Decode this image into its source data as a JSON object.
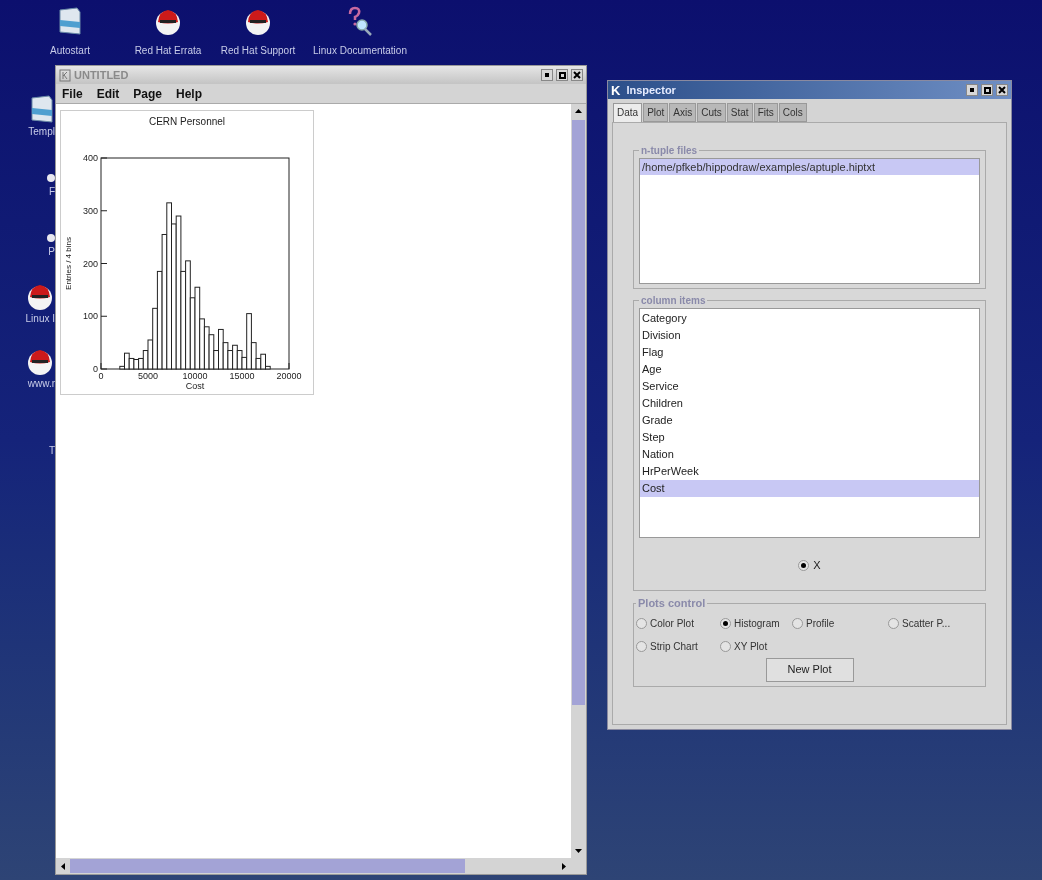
{
  "desktop": {
    "top_icons": [
      {
        "kind": "folder",
        "label": "Autostart"
      },
      {
        "kind": "redhat",
        "label": "Red Hat Errata"
      },
      {
        "kind": "redhat",
        "label": "Red Hat Support"
      },
      {
        "kind": "help",
        "label": "Linux Documentation"
      }
    ],
    "side_icons": [
      {
        "kind": "folder",
        "label": "Templ"
      },
      {
        "kind": "dot",
        "label": "F"
      },
      {
        "kind": "dot",
        "label": "P"
      },
      {
        "kind": "redhat",
        "label": "Linux I"
      },
      {
        "kind": "redhat",
        "label": "www.r"
      },
      {
        "kind": "none",
        "label": "T"
      }
    ]
  },
  "main_window": {
    "title": "UNTITLED",
    "menu": [
      "File",
      "Edit",
      "Page",
      "Help"
    ],
    "plot": {
      "chart_data": {
        "type": "bar",
        "title": "CERN Personnel",
        "xlabel": "Cost",
        "ylabel": "Entries / 4 bins",
        "xlim": [
          0,
          20000
        ],
        "ylim": [
          0,
          400
        ],
        "xticks": [
          0,
          5000,
          10000,
          15000,
          20000
        ],
        "yticks": [
          0,
          100,
          200,
          300,
          400
        ],
        "x": [
          0,
          500,
          1000,
          1500,
          2000,
          2500,
          3000,
          3500,
          4000,
          4500,
          5000,
          5500,
          6000,
          6500,
          7000,
          7500,
          8000,
          8500,
          9000,
          9500,
          10000,
          10500,
          11000,
          11500,
          12000,
          12500,
          13000,
          13500,
          14000,
          14500,
          15000,
          15500,
          16000,
          16500,
          17000,
          17500,
          18000,
          18500,
          19000,
          19500
        ],
        "values": [
          0,
          0,
          0,
          0,
          5,
          30,
          20,
          18,
          20,
          35,
          55,
          115,
          185,
          255,
          315,
          275,
          290,
          185,
          205,
          135,
          155,
          95,
          80,
          65,
          35,
          75,
          50,
          35,
          45,
          35,
          22,
          105,
          50,
          20,
          28,
          5,
          0,
          0,
          0,
          0
        ]
      }
    }
  },
  "inspector": {
    "logo": "K",
    "title": "Inspector",
    "tabs": [
      {
        "label": "Data",
        "selected": true
      },
      {
        "label": "Plot",
        "selected": false
      },
      {
        "label": "Axis",
        "selected": false
      },
      {
        "label": "Cuts",
        "selected": false
      },
      {
        "label": "Stat",
        "selected": false
      },
      {
        "label": "Fits",
        "selected": false
      },
      {
        "label": "Cols",
        "selected": false
      }
    ],
    "ntuple_files": {
      "legend": "n-tuple files",
      "items": [
        {
          "label": "/home/pfkeb/hippodraw/examples/aptuple.hiptxt",
          "selected": true
        }
      ]
    },
    "column_items": {
      "legend": "column items",
      "items": [
        {
          "label": "Category",
          "selected": false
        },
        {
          "label": "Division",
          "selected": false
        },
        {
          "label": "Flag",
          "selected": false
        },
        {
          "label": "Age",
          "selected": false
        },
        {
          "label": "Service",
          "selected": false
        },
        {
          "label": "Children",
          "selected": false
        },
        {
          "label": "Grade",
          "selected": false
        },
        {
          "label": "Step",
          "selected": false
        },
        {
          "label": "Nation",
          "selected": false
        },
        {
          "label": "HrPerWeek",
          "selected": false
        },
        {
          "label": "Cost",
          "selected": true
        }
      ],
      "axes": [
        {
          "label": "X",
          "selected": true
        }
      ]
    },
    "plots_control": {
      "legend": "Plots control",
      "options": [
        {
          "label": "Color Plot",
          "selected": false
        },
        {
          "label": "Histogram",
          "selected": true
        },
        {
          "label": "Profile",
          "selected": false
        },
        {
          "label": "Scatter P...",
          "selected": false
        },
        {
          "label": "Strip Chart",
          "selected": false
        },
        {
          "label": "XY Plot",
          "selected": false
        }
      ],
      "button": "New Plot"
    }
  }
}
